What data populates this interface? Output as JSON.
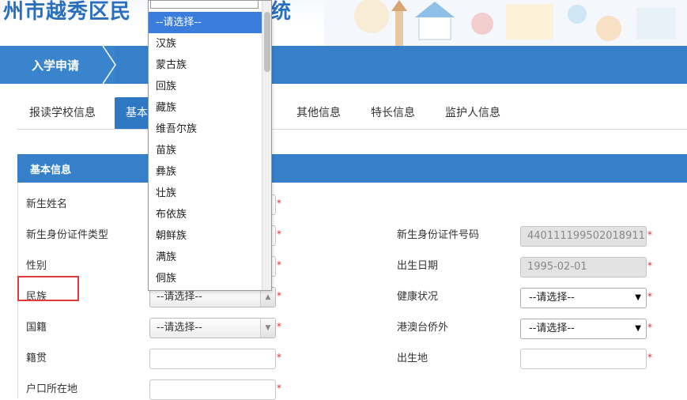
{
  "header": {
    "title_left": "州市越秀区民",
    "title_right": "统"
  },
  "nav": {
    "breadcrumb": "入学申请"
  },
  "tabs": [
    {
      "label": "报读学校信息"
    },
    {
      "label": "基本"
    },
    {
      "label": "其他信息"
    },
    {
      "label": "特长信息"
    },
    {
      "label": "监护人信息"
    }
  ],
  "section": {
    "title": "基本信息"
  },
  "form": {
    "new_name_label": "新生姓名",
    "id_type_label": "新生身份证件类型",
    "gender_label": "性别",
    "ethnicity_label": "民族",
    "ethnicity_value": "--请选择--",
    "nationality_label": "国籍",
    "nationality_value": "--请选择--",
    "native_place_label": "籍贯",
    "household_label": "户口所在地",
    "id_number_label": "新生身份证件号码",
    "id_number_value": "440111199502018911",
    "birth_date_label": "出生日期",
    "birth_date_value": "1995-02-01",
    "health_label": "健康状况",
    "health_value": "--请选择--",
    "hmt_label": "港澳台侨外",
    "hmt_value": "--请选择--",
    "birthplace_label": "出生地",
    "required_mark": "*"
  },
  "dropdown": {
    "options": [
      "--请选择--",
      "汉族",
      "蒙古族",
      "回族",
      "藏族",
      "维吾尔族",
      "苗族",
      "彝族",
      "壮族",
      "布依族",
      "朝鲜族",
      "满族",
      "侗族"
    ]
  },
  "colors": {
    "primary": "#3580c9",
    "highlight": "#e23b3b",
    "required": "#e03030"
  }
}
